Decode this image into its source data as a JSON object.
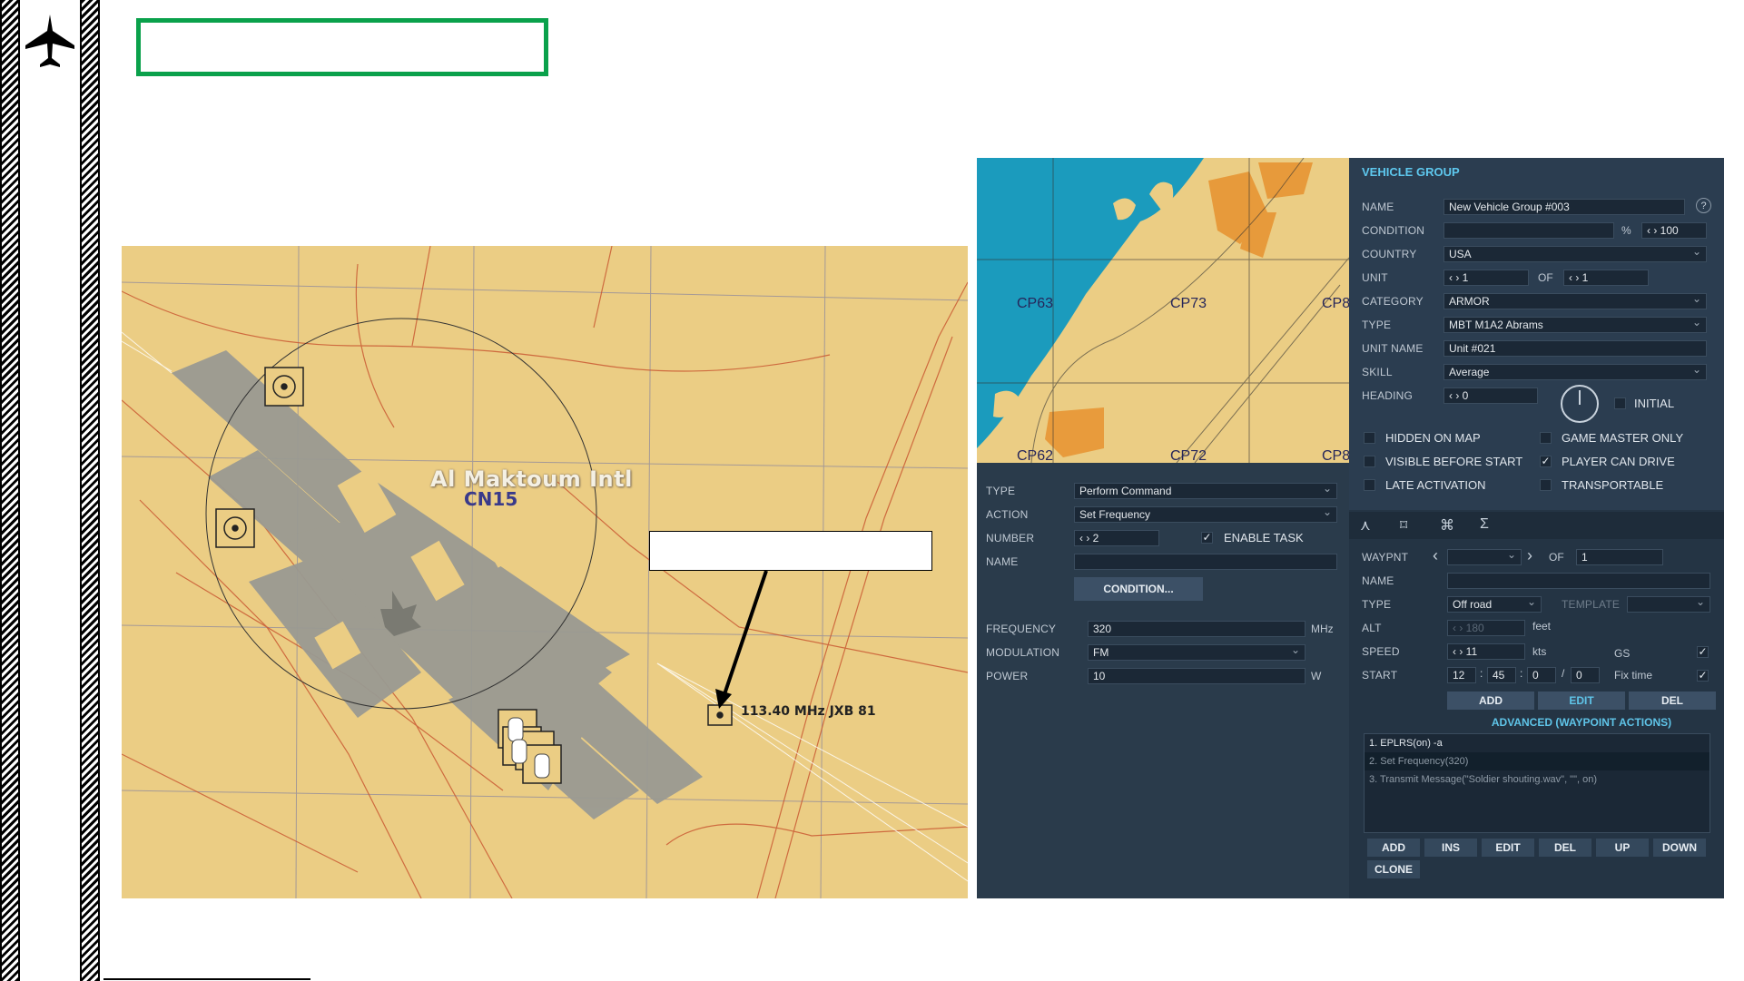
{
  "map": {
    "airport_name": "Al Maktoum Intl",
    "grid_square": "CN15",
    "beacon_label": "113.40 MHz JXB 81"
  },
  "minimap": {
    "grid_labels": [
      "CP63",
      "CP73",
      "CP8",
      "CP62",
      "CP72",
      "CP8"
    ]
  },
  "vehicle_group": {
    "title": "VEHICLE GROUP",
    "help_icon": "question-icon",
    "name_label": "NAME",
    "name_value": "New Vehicle Group #003",
    "condition_label": "CONDITION",
    "condition_value": "",
    "condition_pct": "%",
    "condition_prob": "100",
    "country_label": "COUNTRY",
    "country_value": "USA",
    "unit_label": "UNIT",
    "unit_value": "1",
    "unit_of": "OF",
    "unit_total": "1",
    "category_label": "CATEGORY",
    "category_value": "ARMOR",
    "type_label": "TYPE",
    "type_value": "MBT M1A2 Abrams",
    "unit_name_label": "UNIT NAME",
    "unit_name_value": "Unit #021",
    "skill_label": "SKILL",
    "skill_value": "Average",
    "heading_label": "HEADING",
    "heading_value": "0",
    "initial_label": "INITIAL",
    "hidden_on_map": "HIDDEN ON MAP",
    "game_master_only": "GAME MASTER ONLY",
    "visible_before_start": "VISIBLE BEFORE START",
    "player_can_drive": "PLAYER CAN DRIVE",
    "late_activation": "LATE ACTIVATION",
    "transportable": "TRANSPORTABLE",
    "checkmark": "✓"
  },
  "waypoint": {
    "waypnt_label": "WAYPNT",
    "of_label": "OF",
    "of_value": "1",
    "name_label": "NAME",
    "name_value": "",
    "type_label": "TYPE",
    "type_value": "Off road",
    "template_label": "TEMPLATE",
    "alt_label": "ALT",
    "alt_value": "180",
    "alt_unit": "feet",
    "speed_label": "SPEED",
    "speed_value": "11",
    "speed_unit": "kts",
    "gs_label": "GS",
    "start_label": "START",
    "start_h": "12",
    "start_m": "45",
    "start_s": "0",
    "start_d": "0",
    "fix_time_label": "Fix time",
    "add": "ADD",
    "edit": "EDIT",
    "del": "DEL",
    "advanced": "ADVANCED (WAYPOINT ACTIONS)",
    "actions": [
      "1. EPLRS(on) -a",
      "2. Set Frequency(320)",
      "3. Transmit Message(\"Soldier shouting.wav\", \"\", on)"
    ],
    "list_buttons": [
      "ADD",
      "INS",
      "EDIT",
      "DEL",
      "UP",
      "DOWN"
    ],
    "clone": "CLONE"
  },
  "task": {
    "type_label": "TYPE",
    "type_value": "Perform Command",
    "action_label": "ACTION",
    "action_value": "Set Frequency",
    "number_label": "NUMBER",
    "number_value": "2",
    "enable_task": "ENABLE TASK",
    "name_label": "NAME",
    "name_value": "",
    "condition_button": "CONDITION...",
    "frequency_label": "FREQUENCY",
    "frequency_value": "320",
    "frequency_unit": "MHz",
    "modulation_label": "MODULATION",
    "modulation_value": "FM",
    "power_label": "POWER",
    "power_value": "10",
    "power_unit": "W"
  },
  "icons": {
    "jet": "jet-icon",
    "arrows": "‹ ›",
    "prev": "‹",
    "next": "›",
    "tabs": [
      "route-tab-icon",
      "triggers-tab-icon",
      "payload-tab-icon",
      "summary-tab-icon"
    ],
    "tab_glyphs": [
      "⋏",
      "⌑",
      "⌘",
      "Σ"
    ]
  },
  "colors": {
    "highlight_box": "#0aa14b",
    "accent": "#5ec8ee",
    "map_bg": "#ebcd84"
  }
}
